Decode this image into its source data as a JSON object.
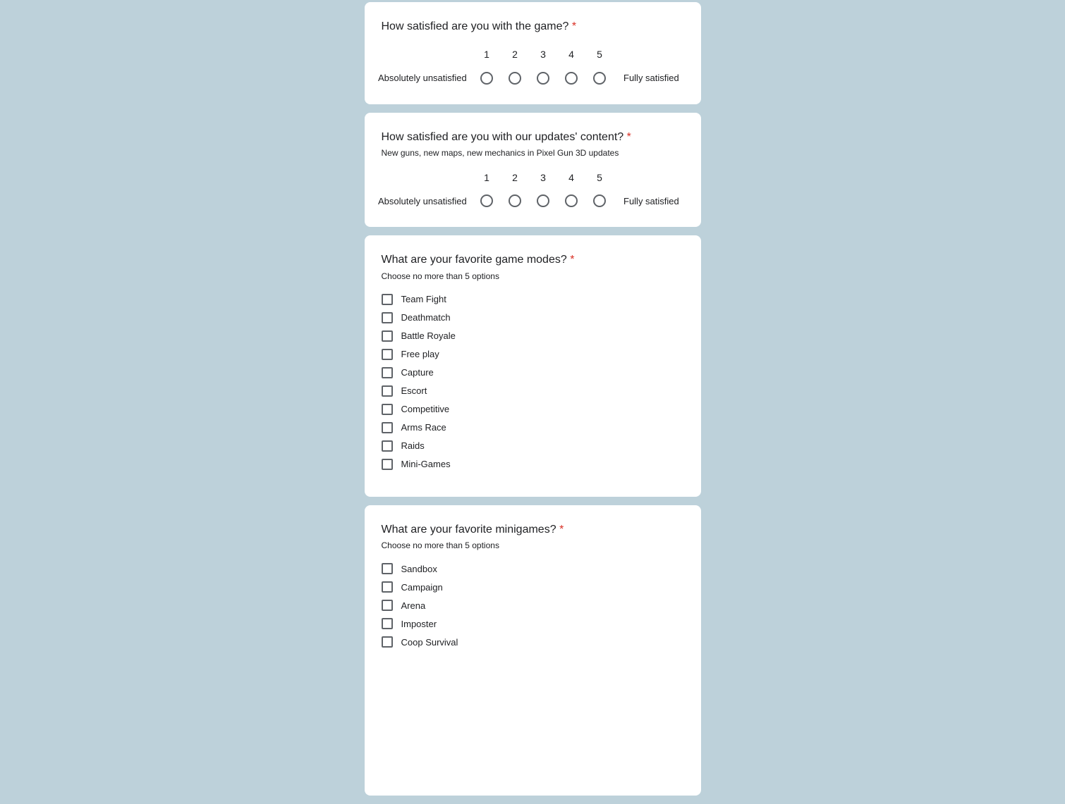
{
  "required_marker": "*",
  "q1": {
    "title": "How satisfied are you with the game?",
    "low_label": "Absolutely unsatisfied",
    "high_label": "Fully satisfied",
    "scale": [
      "1",
      "2",
      "3",
      "4",
      "5"
    ]
  },
  "q2": {
    "title": "How satisfied are you with our updates' content?",
    "desc": "New guns, new maps, new mechanics in Pixel Gun 3D updates",
    "low_label": "Absolutely unsatisfied",
    "high_label": "Fully satisfied",
    "scale": [
      "1",
      "2",
      "3",
      "4",
      "5"
    ]
  },
  "q3": {
    "title": "What are your favorite game modes?",
    "desc": "Choose no more than 5 options",
    "options": [
      "Team Fight",
      "Deathmatch",
      "Battle Royale",
      "Free play",
      "Capture",
      "Escort",
      "Competitive",
      "Arms Race",
      "Raids",
      "Mini-Games"
    ]
  },
  "q4": {
    "title": "What are your favorite minigames?",
    "desc": "Choose no more than 5 options",
    "options": [
      "Sandbox",
      "Campaign",
      "Arena",
      "Imposter",
      "Coop Survival"
    ]
  }
}
